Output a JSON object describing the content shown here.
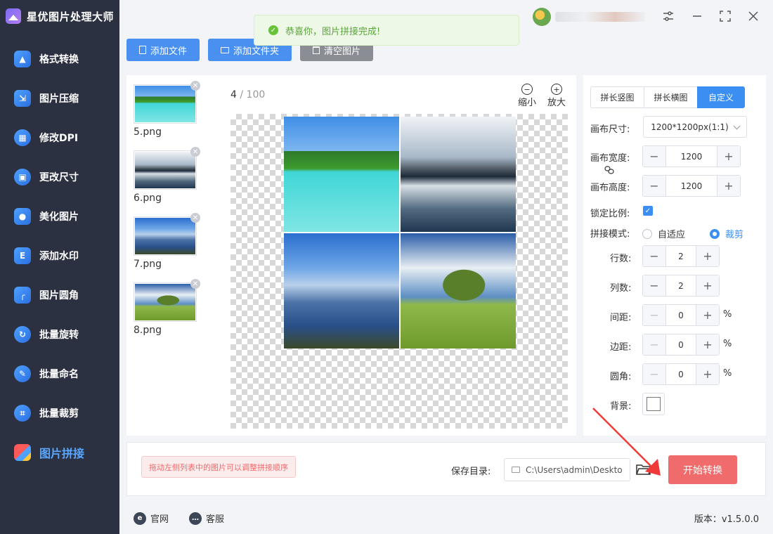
{
  "app": {
    "title": "星优图片处理大师"
  },
  "sidebar": {
    "items": [
      {
        "label": "格式转换",
        "icon": "image-convert-icon"
      },
      {
        "label": "图片压缩",
        "icon": "compress-icon"
      },
      {
        "label": "修改DPI",
        "icon": "dpi-icon"
      },
      {
        "label": "更改尺寸",
        "icon": "resize-icon"
      },
      {
        "label": "美化图片",
        "icon": "beautify-icon"
      },
      {
        "label": "添加水印",
        "icon": "watermark-icon"
      },
      {
        "label": "图片圆角",
        "icon": "round-corner-icon"
      },
      {
        "label": "批量旋转",
        "icon": "rotate-icon"
      },
      {
        "label": "批量命名",
        "icon": "rename-icon"
      },
      {
        "label": "批量裁剪",
        "icon": "crop-icon"
      },
      {
        "label": "图片拼接",
        "icon": "collage-icon",
        "active": true
      }
    ]
  },
  "toolbar": {
    "add_file": "添加文件",
    "add_folder": "添加文件夹",
    "clear_images": "清空图片"
  },
  "toast": {
    "message": "恭喜你，图片拼接完成!"
  },
  "files": [
    {
      "name": "5.png"
    },
    {
      "name": "6.png"
    },
    {
      "name": "7.png"
    },
    {
      "name": "8.png"
    }
  ],
  "preview": {
    "current": "4",
    "separator": " / ",
    "total": "100",
    "zoom_out": "缩小",
    "zoom_in": "放大"
  },
  "settings": {
    "tabs": [
      "拼长竖图",
      "拼长横图",
      "自定义"
    ],
    "active_tab": "自定义",
    "canvas_size_label": "画布尺寸:",
    "canvas_size_value": "1200*1200px(1:1)",
    "canvas_width_label": "画布宽度:",
    "canvas_width": "1200",
    "canvas_height_label": "画布高度:",
    "canvas_height": "1200",
    "lock_ratio_label": "锁定比例:",
    "lock_ratio": true,
    "mode_label": "拼接模式:",
    "mode_adaptive": "自适应",
    "mode_crop": "裁剪",
    "mode_selected": "裁剪",
    "rows_label": "行数:",
    "rows": "2",
    "cols_label": "列数:",
    "cols": "2",
    "spacing_label": "间距:",
    "spacing": "0",
    "margin_label": "边距:",
    "margin": "0",
    "radius_label": "圆角:",
    "radius": "0",
    "percent": "%",
    "background_label": "背景:",
    "background_color": "#ffffff"
  },
  "action": {
    "hint": "拖动左侧列表中的图片可以调整拼接顺序",
    "save_dir_label": "保存目录:",
    "save_dir": "C:\\Users\\admin\\Deskto",
    "start_button": "开始转换"
  },
  "footer": {
    "website": "官网",
    "support": "客服",
    "version": "版本：v1.5.0.0"
  },
  "colors": {
    "sidebar_bg": "#2b3140",
    "primary": "#4a90f0",
    "start_button": "#f06b6b",
    "toast_text": "#5aa53a",
    "arrow": "#f03a3a"
  }
}
